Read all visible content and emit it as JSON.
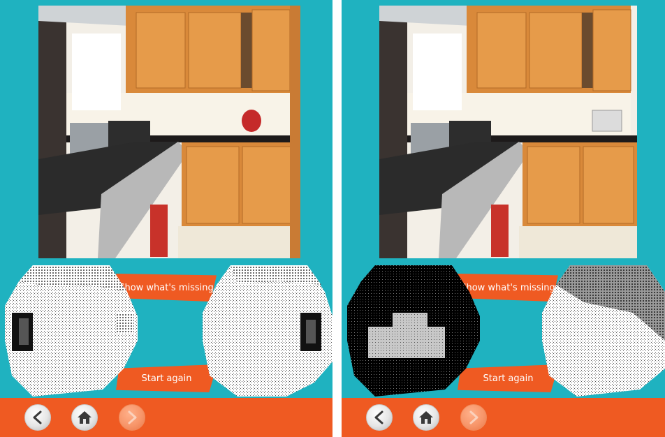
{
  "panels": [
    {
      "id": "left",
      "show_label": "Show what's missing",
      "again_label": "Start again",
      "nav": {
        "back": "back-arrow-icon",
        "home": "home-icon",
        "next": "forward-arrow-icon"
      }
    },
    {
      "id": "right",
      "show_label": "Show what's missing",
      "again_label": "Start again",
      "nav": {
        "back": "back-arrow-icon",
        "home": "home-icon",
        "next": "forward-arrow-icon"
      }
    }
  ],
  "colors": {
    "teal_background": "#1fb2c0",
    "accent_orange": "#ef5a22",
    "cabinet_wood": "#d9893a"
  }
}
